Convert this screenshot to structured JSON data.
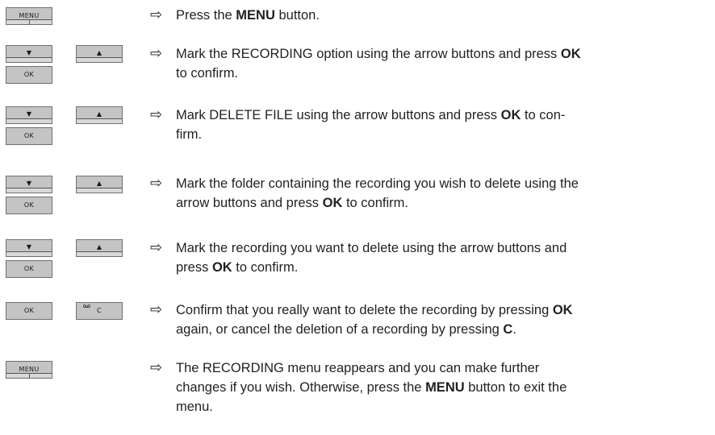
{
  "keys": {
    "menu": "MENU",
    "down": "▼",
    "up": "▲",
    "ok": "OK",
    "c": "C",
    "c_icon": "voicemail-icon"
  },
  "arrow_glyph": "⇨",
  "steps": [
    {
      "pre": "Press the ",
      "bold": "MENU",
      "post": " button."
    },
    {
      "pre": "Mark the RECORDING option using the arrow buttons and press ",
      "bold": "OK",
      "post": "",
      "line2": "to confirm."
    },
    {
      "pre": "Mark DELETE FILE using the arrow buttons and press ",
      "bold": "OK",
      "post": " to con-",
      "line2": "firm."
    },
    {
      "line1": "Mark the folder containing the recording you wish to delete using the",
      "pre": "arrow buttons and press ",
      "bold": "OK",
      "post": " to confirm."
    },
    {
      "line1": "Mark the recording you want to delete using the arrow buttons and",
      "pre": "press ",
      "bold": "OK",
      "post": " to confirm."
    },
    {
      "pre": "Confirm that you really want to delete the recording by pressing ",
      "bold": "OK",
      "pre2": "again, or cancel the deletion of a recording by pressing ",
      "bold2": "C",
      "post2": "."
    },
    {
      "line1": "The RECORDING menu reappears and you can make further",
      "pre": "changes if you wish. Otherwise, press the ",
      "bold": "MENU",
      "post": " button to exit the",
      "line3": "menu."
    }
  ]
}
